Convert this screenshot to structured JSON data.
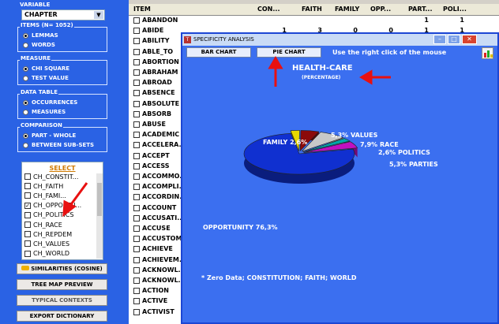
{
  "left": {
    "variable": {
      "title": "VARIABLE",
      "selected": "CHAPTER"
    },
    "items": {
      "title": "ITEMS (N= 1052)",
      "options": [
        "LEMMAS",
        "WORDS"
      ],
      "selected": 0
    },
    "measure": {
      "title": "MEASURE",
      "options": [
        "CHI SQUARE",
        "TEST VALUE"
      ],
      "selected": 0
    },
    "datatable": {
      "title": "DATA TABLE",
      "options": [
        "OCCURRENCES",
        "MEASURES"
      ],
      "selected": 0
    },
    "comparison": {
      "title": "COMPARISON",
      "options": [
        "PART - WHOLE",
        "BETWEEN SUB-SETS"
      ],
      "selected": 0
    },
    "select": {
      "header": "SELECT",
      "items": [
        {
          "label": "CH_CONSTIT...",
          "checked": false
        },
        {
          "label": "CH_FAITH",
          "checked": false
        },
        {
          "label": "CH_FAMI...",
          "checked": false
        },
        {
          "label": "CH_OPPORTU...",
          "checked": true
        },
        {
          "label": "CH_POLITICS",
          "checked": false
        },
        {
          "label": "CH_RACE",
          "checked": false
        },
        {
          "label": "CH_REPDEM",
          "checked": false
        },
        {
          "label": "CH_VALUES",
          "checked": false
        },
        {
          "label": "CH_WORLD",
          "checked": false
        }
      ]
    },
    "buttons": [
      "SIMILARITIES (COSINE)",
      "TREE MAP PREVIEW",
      "TYPICAL CONTEXTS",
      "EXPORT DICTIONARY"
    ]
  },
  "table": {
    "headers": [
      "ITEM",
      "CON...",
      "FAITH",
      "FAMILY",
      "OPP...",
      "PART...",
      "POLI..."
    ],
    "rows": [
      {
        "item": "ABANDON",
        "vals": [
          "",
          "",
          "",
          "",
          "1",
          "1"
        ]
      },
      {
        "item": "ABIDE",
        "vals": [
          "1",
          "3",
          "0",
          "0",
          "1",
          "1"
        ]
      },
      {
        "item": "ABILITY",
        "vals": []
      },
      {
        "item": "ABLE_TO",
        "vals": []
      },
      {
        "item": "ABORTION",
        "vals": []
      },
      {
        "item": "ABRAHAM",
        "vals": []
      },
      {
        "item": "ABROAD",
        "vals": []
      },
      {
        "item": "ABSENCE",
        "vals": []
      },
      {
        "item": "ABSOLUTE",
        "vals": []
      },
      {
        "item": "ABSORB",
        "vals": []
      },
      {
        "item": "ABUSE",
        "vals": []
      },
      {
        "item": "ACADEMIC",
        "vals": []
      },
      {
        "item": "ACCELERA...",
        "vals": []
      },
      {
        "item": "ACCEPT",
        "vals": []
      },
      {
        "item": "ACCESS",
        "vals": []
      },
      {
        "item": "ACCOMMO...",
        "vals": []
      },
      {
        "item": "ACCOMPLI...",
        "vals": []
      },
      {
        "item": "ACCORDIN...",
        "vals": []
      },
      {
        "item": "ACCOUNT",
        "vals": []
      },
      {
        "item": "ACCUSATI...",
        "vals": []
      },
      {
        "item": "ACCUSE",
        "vals": []
      },
      {
        "item": "ACCUSTOM...",
        "vals": []
      },
      {
        "item": "ACHIEVE",
        "vals": []
      },
      {
        "item": "ACHIEVEM...",
        "vals": []
      },
      {
        "item": "ACKNOWL...",
        "vals": []
      },
      {
        "item": "ACKNOWL...",
        "vals": []
      },
      {
        "item": "ACTION",
        "vals": []
      },
      {
        "item": "ACTIVE",
        "vals": []
      },
      {
        "item": "ACTIVIST",
        "vals": []
      }
    ]
  },
  "window": {
    "title": "SPECIFICITY ANALYSIS",
    "bar_chart_label": "BAR CHART",
    "pie_chart_label": "PIE CHART",
    "hint": "Use the right click of the mouse",
    "footnote": "* Zero Data; CONSTITUTION; FAITH; WORLD"
  },
  "chart_data": {
    "type": "pie",
    "title": "HEALTH-CARE",
    "subtitle": "(PERCENTAGE)",
    "slices": [
      {
        "label": "FAMILY",
        "value": 2.6,
        "text": "FAMILY  2,6%",
        "color": "#e8d800"
      },
      {
        "label": "VALUES",
        "value": 5.3,
        "text": "5,3%  VALUES",
        "color": "#8b0a0a"
      },
      {
        "label": "RACE",
        "value": 7.9,
        "text": "7,9%  RACE",
        "color": "#c8c8c8"
      },
      {
        "label": "POLITICS",
        "value": 2.6,
        "text": "2,6%  POLITICS",
        "color": "#00a8a8"
      },
      {
        "label": "PARTIES",
        "value": 5.3,
        "text": "5,3%  PARTIES",
        "color": "#c010c0"
      },
      {
        "label": "OPPORTUNITY",
        "value": 76.3,
        "text": "OPPORTUNITY  76,3%",
        "color": "#1030d0"
      }
    ]
  }
}
